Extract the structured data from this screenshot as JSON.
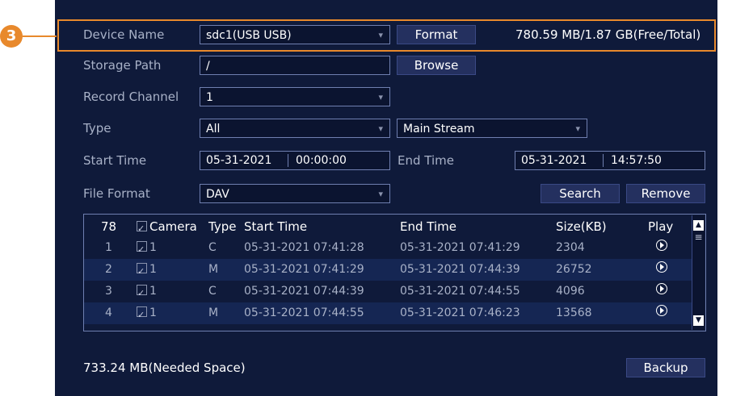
{
  "callout": "3",
  "device": {
    "label": "Device Name",
    "value": "sdc1(USB USB)",
    "format_button": "Format",
    "space": "780.59 MB/1.87 GB(Free/Total)"
  },
  "storage_path": {
    "label": "Storage Path",
    "value": "/",
    "browse_button": "Browse"
  },
  "record_channel": {
    "label": "Record Channel",
    "value": "1"
  },
  "type": {
    "label": "Type",
    "value": "All",
    "stream": "Main Stream"
  },
  "start_time": {
    "label": "Start Time",
    "date": "05-31-2021",
    "time": "00:00:00"
  },
  "end_time": {
    "label": "End Time",
    "date": "05-31-2021",
    "time": "14:57:50"
  },
  "file_format": {
    "label": "File Format",
    "value": "DAV"
  },
  "buttons": {
    "search": "Search",
    "remove": "Remove",
    "backup": "Backup"
  },
  "table": {
    "headers": {
      "count": "78",
      "camera": "Camera",
      "type": "Type",
      "start": "Start Time",
      "end": "End Time",
      "size": "Size(KB)",
      "play": "Play"
    },
    "rows": [
      {
        "idx": "1",
        "camera": "1",
        "type": "C",
        "start": "05-31-2021 07:41:28",
        "end": "05-31-2021 07:41:29",
        "size": "2304"
      },
      {
        "idx": "2",
        "camera": "1",
        "type": "M",
        "start": "05-31-2021 07:41:29",
        "end": "05-31-2021 07:44:39",
        "size": "26752"
      },
      {
        "idx": "3",
        "camera": "1",
        "type": "C",
        "start": "05-31-2021 07:44:39",
        "end": "05-31-2021 07:44:55",
        "size": "4096"
      },
      {
        "idx": "4",
        "camera": "1",
        "type": "M",
        "start": "05-31-2021 07:44:55",
        "end": "05-31-2021 07:46:23",
        "size": "13568"
      }
    ]
  },
  "needed_space": "733.24 MB(Needed Space)",
  "colors": {
    "panel": "#0f1a3a",
    "accent": "#e8892c",
    "button": "#24305f",
    "row_alt": "#152653"
  }
}
